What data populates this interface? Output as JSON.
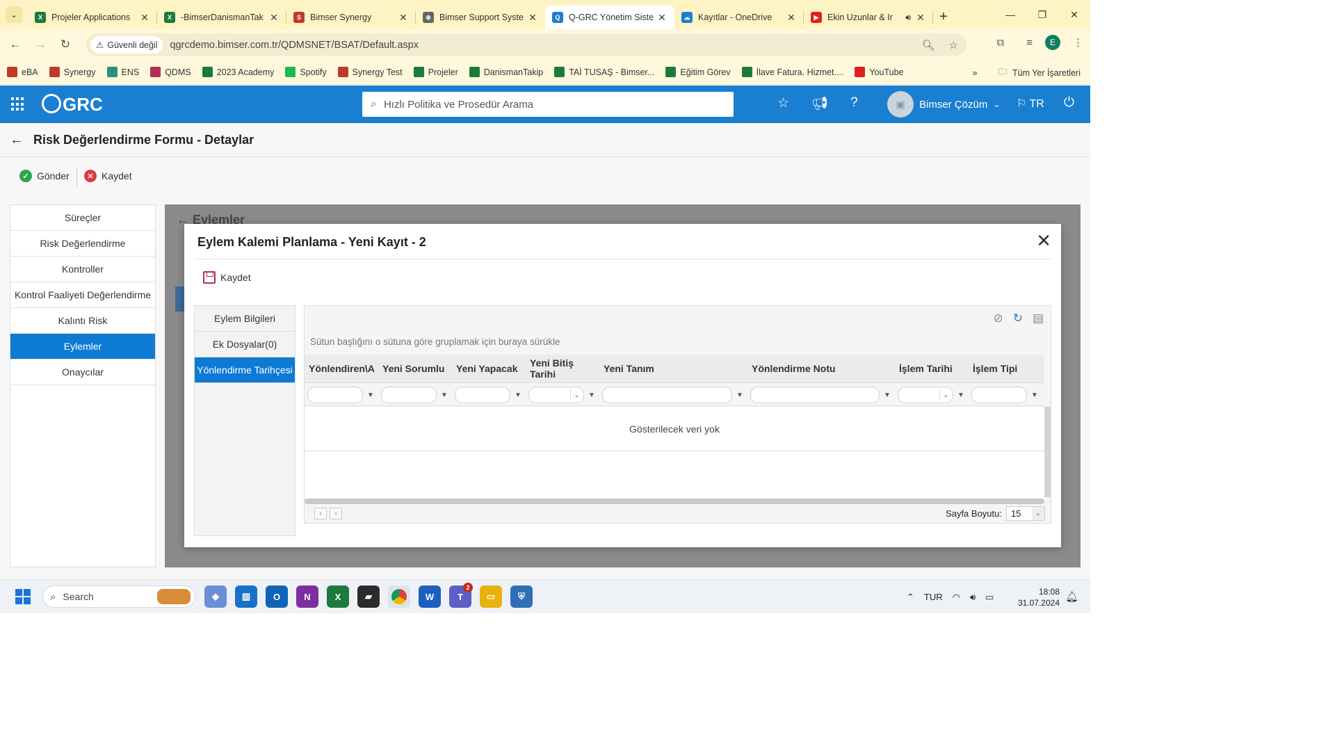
{
  "browser": {
    "tabs": [
      {
        "title": "Projeler Applications",
        "color": "#1d7a3e",
        "glyph": "X"
      },
      {
        "title": "-BimserDanismanTak",
        "color": "#1d7a3e",
        "glyph": "X"
      },
      {
        "title": "Bimser Synergy",
        "color": "#c0392b",
        "glyph": "S"
      },
      {
        "title": "Bimser Support Syste",
        "color": "#666666",
        "glyph": "⊕"
      },
      {
        "title": "Q-GRC Yönetim Siste",
        "color": "#1a7fd1",
        "glyph": "Q"
      },
      {
        "title": "Kayıtlar - OneDrive",
        "color": "#1a7fd1",
        "glyph": "☁"
      },
      {
        "title": "Ekin Uzunlar & Ir",
        "color": "#e02020",
        "glyph": "▶"
      }
    ],
    "security_label": "Güvenli değil",
    "url": "qgrcdemo.bimser.com.tr/QDMSNET/BSAT/Default.aspx",
    "profile_initial": "E",
    "bookmarks": [
      {
        "label": "eBA",
        "color": "#c0392b"
      },
      {
        "label": "Synergy",
        "color": "#c0392b"
      },
      {
        "label": "ENS",
        "color": "#2c8f7a"
      },
      {
        "label": "QDMS",
        "color": "#b0305a"
      },
      {
        "label": "2023 Academy",
        "color": "#1d7a3e"
      },
      {
        "label": "Spotify",
        "color": "#1db954"
      },
      {
        "label": "Synergy Test",
        "color": "#c0392b"
      },
      {
        "label": "Projeler",
        "color": "#1d7a3e"
      },
      {
        "label": "DanismanTakip",
        "color": "#1d7a3e"
      },
      {
        "label": "TAİ TUSAŞ - Bimser...",
        "color": "#1d7a3e"
      },
      {
        "label": "Eğitim Görev",
        "color": "#1d7a3e"
      },
      {
        "label": "İlave Fatura. Hizmet....",
        "color": "#1d7a3e"
      },
      {
        "label": "YouTube",
        "color": "#e02020"
      }
    ],
    "all_bookmarks_label": "Tüm Yer İşaretleri"
  },
  "app": {
    "logo": "GRC",
    "search_placeholder": "Hızlı Politika ve Prosedür Arama",
    "user_name": "Bimser Çözüm",
    "language": "TR"
  },
  "page": {
    "title": "Risk Değerlendirme Formu - Detaylar",
    "send_label": "Gönder",
    "save_label": "Kaydet",
    "left_menu": [
      {
        "label": "Süreçler",
        "active": false
      },
      {
        "label": "Risk Değerlendirme",
        "active": false
      },
      {
        "label": "Kontroller",
        "active": false
      },
      {
        "label": "Kontrol Faaliyeti Değerlendirme",
        "active": false
      },
      {
        "label": "Kalıntı Risk",
        "active": false
      },
      {
        "label": "Eylemler",
        "active": true
      },
      {
        "label": "Onaycılar",
        "active": false
      }
    ],
    "background_panel_title": "Eylemler"
  },
  "modal": {
    "title": "Eylem Kalemi Planlama - Yeni Kayıt - 2",
    "save_label": "Kaydet",
    "side_tabs": [
      {
        "label": "Eylem Bilgileri",
        "active": false
      },
      {
        "label": "Ek Dosyalar(0)",
        "active": false
      },
      {
        "label": "Yönlendirme Tarihçesi",
        "active": true
      }
    ],
    "group_hint": "Sütun başlığını o sütuna göre gruplamak için buraya sürükle",
    "columns": [
      {
        "label": "Yönlendiren\\A",
        "filter_type": "text"
      },
      {
        "label": "Yeni Sorumlu",
        "filter_type": "text"
      },
      {
        "label": "Yeni Yapacak",
        "filter_type": "text"
      },
      {
        "label": "Yeni Bitiş Tarihi",
        "filter_type": "date"
      },
      {
        "label": "Yeni Tanım",
        "filter_type": "text"
      },
      {
        "label": "Yönlendirme Notu",
        "filter_type": "text"
      },
      {
        "label": "İşlem Tarihi",
        "filter_type": "date"
      },
      {
        "label": "İşlem Tipi",
        "filter_type": "text"
      }
    ],
    "no_data": "Gösterilecek veri yok",
    "page_size_label": "Sayfa Boyutu:",
    "page_size_value": "15"
  },
  "taskbar": {
    "search_label": "Search",
    "teams_badge": "2",
    "language": "TUR",
    "time": "18:08",
    "date": "31.07.2024"
  }
}
